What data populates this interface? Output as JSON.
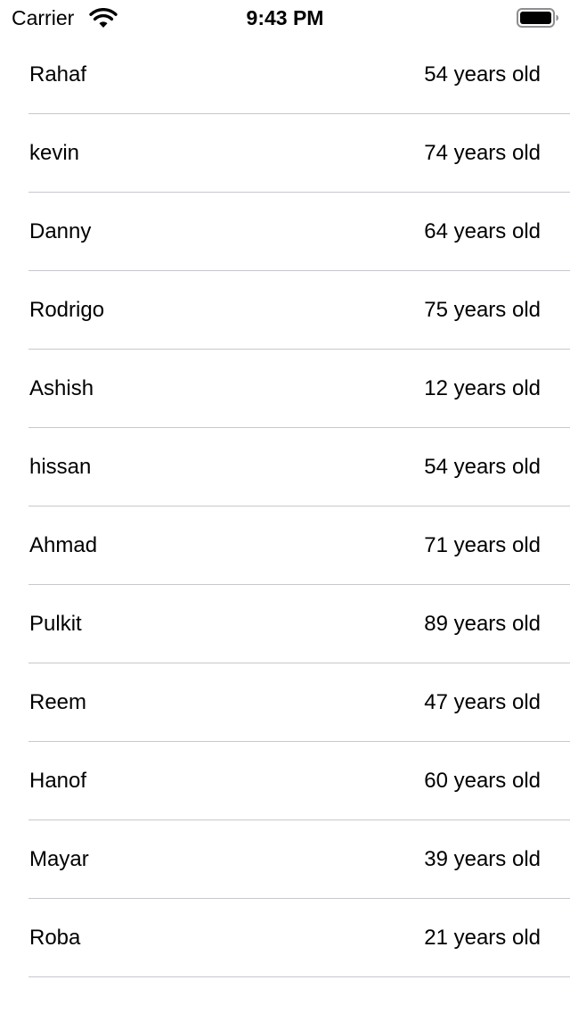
{
  "status_bar": {
    "carrier": "Carrier",
    "time": "9:43 PM",
    "wifi_icon": "wifi-icon",
    "battery_icon": "battery-icon"
  },
  "people": [
    {
      "name": "Rahaf",
      "age": "54 years old"
    },
    {
      "name": "kevin",
      "age": "74 years old"
    },
    {
      "name": "Danny",
      "age": "64 years old"
    },
    {
      "name": "Rodrigo",
      "age": "75 years old"
    },
    {
      "name": "Ashish",
      "age": "12 years old"
    },
    {
      "name": "hissan",
      "age": "54 years old"
    },
    {
      "name": "Ahmad",
      "age": "71 years old"
    },
    {
      "name": "Pulkit",
      "age": "89 years old"
    },
    {
      "name": "Reem",
      "age": "47 years old"
    },
    {
      "name": "Hanof",
      "age": "60 years old"
    },
    {
      "name": "Mayar",
      "age": "39 years old"
    },
    {
      "name": "Roba",
      "age": "21 years old"
    }
  ]
}
